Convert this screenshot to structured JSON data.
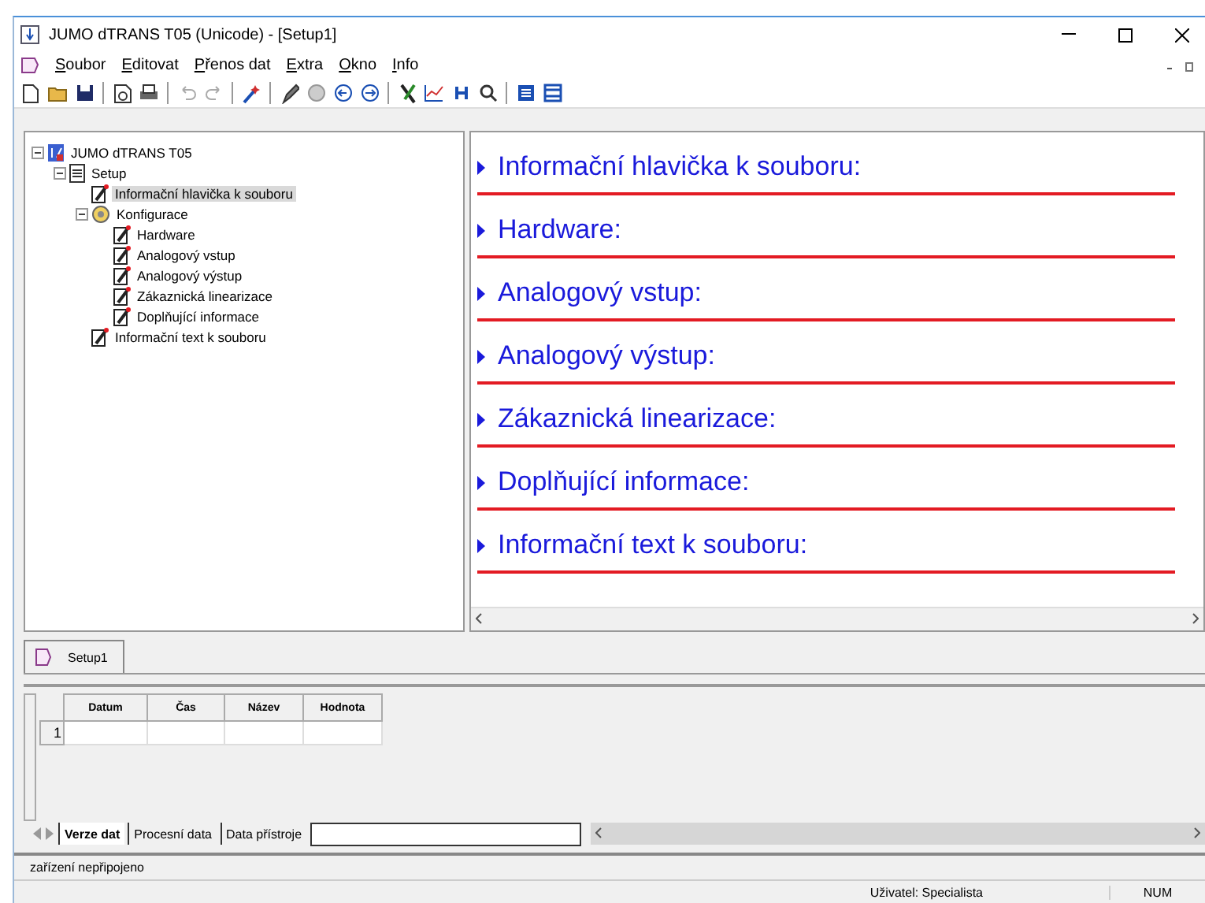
{
  "window": {
    "title": "JUMO dTRANS T05 (Unicode) - [Setup1]"
  },
  "menu": [
    {
      "label": "Soubor"
    },
    {
      "label": "Editovat"
    },
    {
      "label": "Přenos dat"
    },
    {
      "label": "Extra"
    },
    {
      "label": "Okno"
    },
    {
      "label": "Info"
    }
  ],
  "toolbar": [
    {
      "kind": "new"
    },
    {
      "kind": "open"
    },
    {
      "kind": "save"
    },
    {
      "kind": "sep"
    },
    {
      "kind": "preview"
    },
    {
      "kind": "print"
    },
    {
      "kind": "sep"
    },
    {
      "kind": "undo",
      "disabled": true
    },
    {
      "kind": "redo",
      "disabled": true
    },
    {
      "kind": "sep"
    },
    {
      "kind": "wand"
    },
    {
      "kind": "sep"
    },
    {
      "kind": "pen"
    },
    {
      "kind": "disc",
      "disabled": true
    },
    {
      "kind": "left"
    },
    {
      "kind": "right"
    },
    {
      "kind": "sep"
    },
    {
      "kind": "tools"
    },
    {
      "kind": "chart"
    },
    {
      "kind": "marker"
    },
    {
      "kind": "search"
    },
    {
      "kind": "sep"
    },
    {
      "kind": "list"
    },
    {
      "kind": "rows"
    }
  ],
  "tree": [
    {
      "label": "JUMO dTRANS T05",
      "kind": "device",
      "expanded": true,
      "selected": false,
      "children": [
        {
          "label": "Setup",
          "kind": "setup",
          "expanded": true,
          "selected": false,
          "children": [
            {
              "label": "Informační hlavička k souboru",
              "kind": "page",
              "selected": true
            },
            {
              "label": "Konfigurace",
              "kind": "config",
              "expanded": true,
              "selected": false,
              "children": [
                {
                  "label": "Hardware",
                  "kind": "page",
                  "selected": false
                },
                {
                  "label": "Analogový vstup",
                  "kind": "page",
                  "selected": false
                },
                {
                  "label": "Analogový výstup",
                  "kind": "page",
                  "selected": false
                },
                {
                  "label": "Zákaznická linearizace",
                  "kind": "page",
                  "selected": false
                },
                {
                  "label": "Doplňující informace",
                  "kind": "page",
                  "selected": false
                }
              ]
            },
            {
              "label": "Informační text k souboru",
              "kind": "page",
              "selected": false
            }
          ]
        }
      ]
    }
  ],
  "sections": [
    {
      "title": "Informační hlavička k souboru:"
    },
    {
      "title": "Hardware:"
    },
    {
      "title": "Analogový vstup:"
    },
    {
      "title": "Analogový výstup:"
    },
    {
      "title": "Zákaznická linearizace:"
    },
    {
      "title": "Doplňující informace:"
    },
    {
      "title": "Informační text k souboru:"
    }
  ],
  "document_tabs": [
    {
      "label": "Setup1",
      "selected": true
    }
  ],
  "table": {
    "columns": [
      "Datum",
      "Čas",
      "Název",
      "Hodnota"
    ],
    "rows": [
      {
        "number": "1",
        "cells": [
          "",
          "",
          "",
          ""
        ]
      }
    ]
  },
  "sheet_tabs": [
    {
      "label": "Verze dat",
      "selected": true
    },
    {
      "label": "Procesní data",
      "selected": false
    },
    {
      "label": "Data přístroje",
      "selected": false
    }
  ],
  "status_bar": {
    "message": "zařízení nepřipojeno",
    "user": "Uživatel: Specialista",
    "num": "NUM"
  }
}
